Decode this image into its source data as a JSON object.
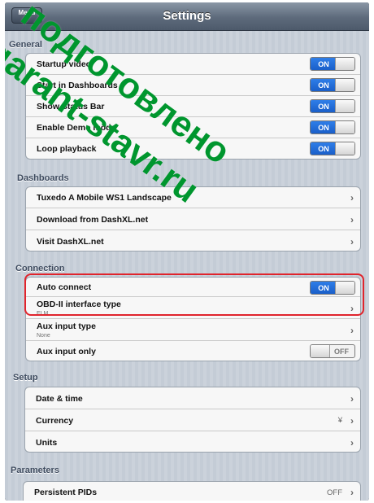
{
  "navbar": {
    "menu_label": "Menu",
    "title": "Settings"
  },
  "sections": {
    "general": "General",
    "dashboards": "Dashboards",
    "connection": "Connection",
    "setup": "Setup",
    "parameters": "Parameters"
  },
  "general": {
    "rows": [
      {
        "label": "Startup video",
        "toggle": "ON"
      },
      {
        "label": "Start in Dashboards",
        "toggle": "ON"
      },
      {
        "label": "Show Status Bar",
        "toggle": "ON"
      },
      {
        "label": "Enable Demo mode",
        "toggle": "ON"
      },
      {
        "label": "Loop playback",
        "toggle": "ON"
      }
    ]
  },
  "dashboards": {
    "rows": [
      {
        "label": "Tuxedo A Mobile WS1 Landscape"
      },
      {
        "label": "Download from DashXL.net"
      },
      {
        "label": "Visit DashXL.net"
      }
    ]
  },
  "connection": {
    "auto_connect": {
      "label": "Auto connect",
      "toggle": "ON"
    },
    "obd": {
      "label": "OBD-II interface type",
      "value": "ELM"
    },
    "aux_type": {
      "label": "Aux input type",
      "value": "None"
    },
    "aux_only": {
      "label": "Aux input only",
      "toggle": "OFF"
    }
  },
  "setup": {
    "rows": [
      {
        "label": "Date & time"
      },
      {
        "label": "Currency",
        "value": "¥"
      },
      {
        "label": "Units"
      }
    ]
  },
  "parameters": {
    "persistent": {
      "label": "Persistent PIDs",
      "value": "OFF"
    }
  },
  "icons": {
    "chevron": "chevron-right-icon"
  },
  "watermark": {
    "line1": "подготовлено",
    "line2": "garant-stavr.ru",
    "color": "#00962e"
  },
  "colors": {
    "toggle_on": "#1a5fc9",
    "highlight": "#e0242c",
    "nav": "#5d6a7b"
  }
}
